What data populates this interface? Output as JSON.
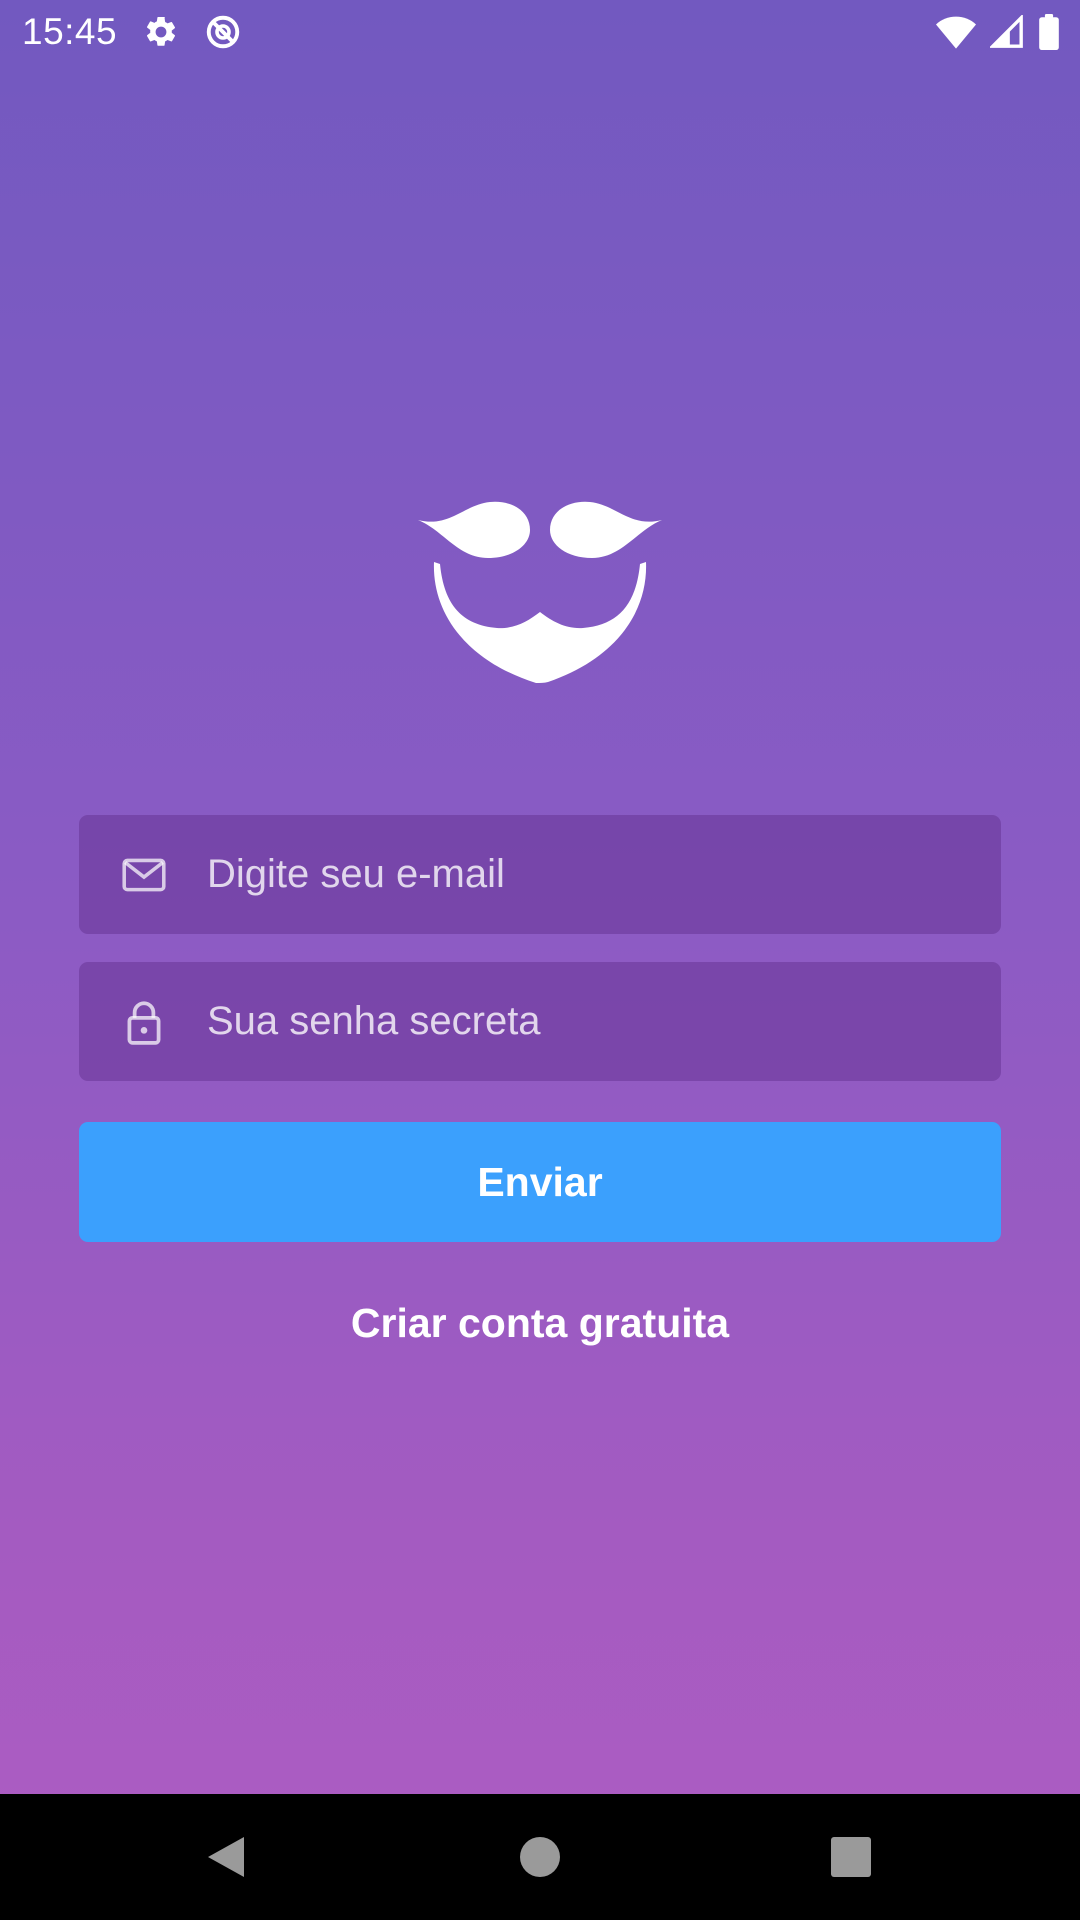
{
  "status_bar": {
    "time": "15:45",
    "left_icons": [
      "settings-icon",
      "do-not-disturb-icon"
    ],
    "right_icons": [
      "wifi-icon",
      "cell-signal-icon",
      "battery-icon"
    ]
  },
  "colors": {
    "gradient_top": "#7259c0",
    "gradient_bottom": "#ae5cc2",
    "button": "#3ba0fd",
    "field_bg": "rgba(95,45,140,0.45)"
  },
  "logo": {
    "icon": "mustache-beard-logo"
  },
  "login_form": {
    "email": {
      "icon": "mail-icon",
      "placeholder": "Digite seu e-mail",
      "value": ""
    },
    "password": {
      "icon": "lock-icon",
      "placeholder": "Sua senha secreta",
      "value": ""
    },
    "submit_label": "Enviar",
    "create_account_label": "Criar conta gratuita"
  },
  "nav_bar": {
    "buttons": [
      "back-icon",
      "home-icon",
      "recents-icon"
    ]
  }
}
